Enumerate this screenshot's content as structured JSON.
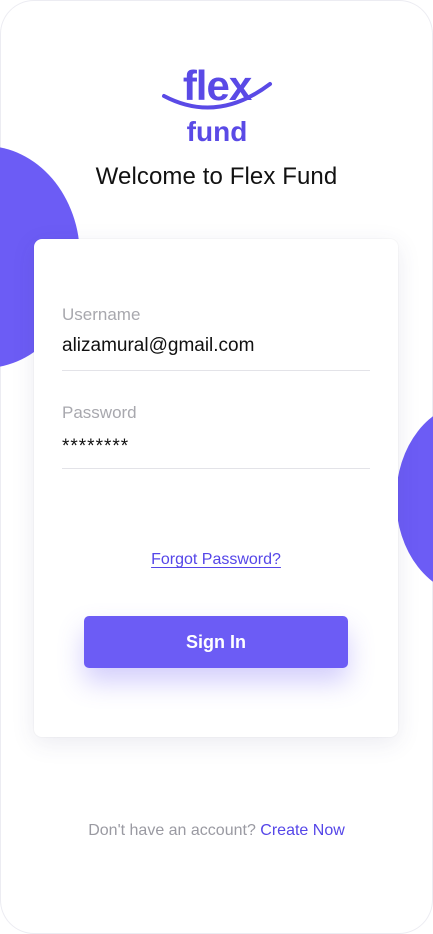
{
  "brand": {
    "logo_line1": "flex",
    "logo_line2": "fund",
    "accent_color": "#6c5cf5",
    "link_color": "#5546e8"
  },
  "header": {
    "title": "Welcome to Flex Fund"
  },
  "form": {
    "username_label": "Username",
    "username_value": "alizamural@gmail.com",
    "password_label": "Password",
    "password_value": "********",
    "forgot_label": "Forgot Password?",
    "signin_label": "Sign In"
  },
  "footer": {
    "prompt": "Don't have an account?",
    "link": "Create Now"
  }
}
